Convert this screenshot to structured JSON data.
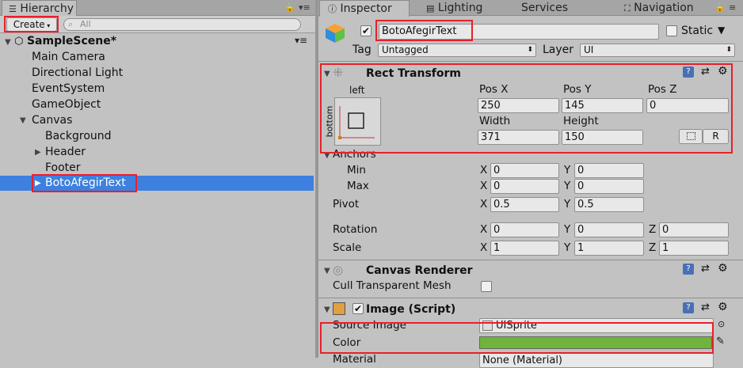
{
  "hierarchy": {
    "tab_label": "Hierarchy",
    "create_label": "Create",
    "search_placeholder": "All",
    "scene_name": "SampleScene*",
    "items": [
      "Main Camera",
      "Directional Light",
      "EventSystem",
      "GameObject",
      "Canvas",
      "Background",
      "Header",
      "Footer",
      "BotoAfegirText"
    ]
  },
  "tabs": {
    "inspector": "Inspector",
    "lighting": "Lighting",
    "services": "Services",
    "navigation": "Navigation"
  },
  "object": {
    "name": "BotoAfegirText",
    "static_label": "Static",
    "tag_label": "Tag",
    "tag_value": "Untagged",
    "layer_label": "Layer",
    "layer_value": "UI"
  },
  "rect_transform": {
    "title": "Rect Transform",
    "anchor_h": "left",
    "anchor_v": "bottom",
    "pos_x_label": "Pos X",
    "pos_y_label": "Pos Y",
    "pos_z_label": "Pos Z",
    "pos_x": "250",
    "pos_y": "145",
    "pos_z": "0",
    "width_label": "Width",
    "height_label": "Height",
    "width": "371",
    "height": "150",
    "r_label": "R",
    "anchors_label": "Anchors",
    "min_label": "Min",
    "max_label": "Max",
    "anchor_min_x": "0",
    "anchor_min_y": "0",
    "anchor_max_x": "0",
    "anchor_max_y": "0",
    "pivot_label": "Pivot",
    "pivot_x": "0.5",
    "pivot_y": "0.5",
    "rotation_label": "Rotation",
    "rot_x": "0",
    "rot_y": "0",
    "rot_z": "0",
    "scale_label": "Scale",
    "scale_x": "1",
    "scale_y": "1",
    "scale_z": "1",
    "x": "X",
    "y": "Y",
    "z": "Z"
  },
  "canvas_renderer": {
    "title": "Canvas Renderer",
    "cull_label": "Cull Transparent Mesh"
  },
  "image_script": {
    "title": "Image (Script)",
    "source_label": "Source Image",
    "source_value": "UISprite",
    "color_label": "Color",
    "color_value": "#6fb43c",
    "material_label": "Material",
    "material_value": "None (Material)"
  },
  "colors": {
    "panel": "#c2c2c2",
    "selection": "#3d80df",
    "highlight": "#e8202a"
  }
}
